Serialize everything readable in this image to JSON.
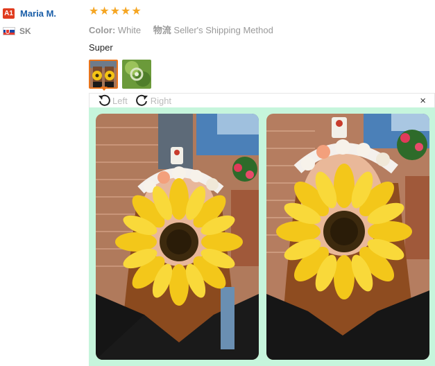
{
  "reviewer": {
    "badge": "A1",
    "name": "Maria M.",
    "country_code": "SK",
    "flag_icon": "slovakia-flag-icon"
  },
  "review": {
    "rating": 5,
    "stars": [
      "★",
      "★",
      "★",
      "★",
      "★"
    ],
    "color_label": "Color:",
    "color_value": "White",
    "shipping_label": "物流",
    "shipping_value": "Seller's Shipping Method",
    "text": "Super"
  },
  "viewer": {
    "rotate_left_label": "Left",
    "rotate_right_label": "Right",
    "close_glyph": "×"
  },
  "colors": {
    "accent_orange": "#e8741c",
    "star": "#f5a623",
    "link_blue": "#1a5ea8",
    "viewer_bg": "#c6f5dc"
  }
}
